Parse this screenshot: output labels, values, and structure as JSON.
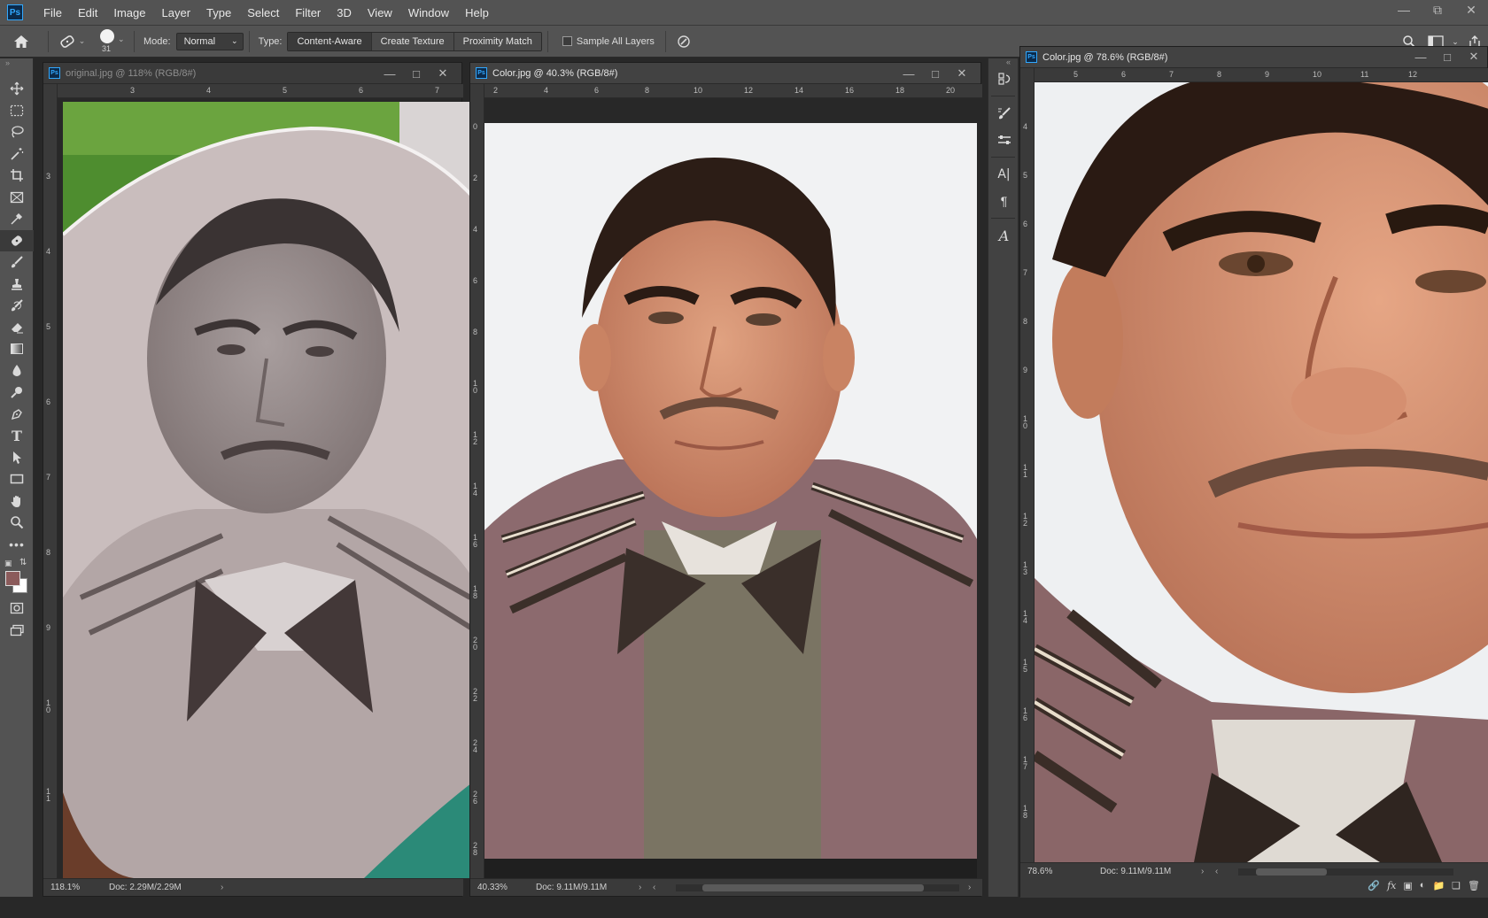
{
  "app": {
    "icon_text": "Ps"
  },
  "menu": [
    "File",
    "Edit",
    "Image",
    "Layer",
    "Type",
    "Select",
    "Filter",
    "3D",
    "View",
    "Window",
    "Help"
  ],
  "options": {
    "brush_size": "31",
    "mode_label": "Mode:",
    "mode_value": "Normal",
    "type_label": "Type:",
    "type_buttons": [
      "Content-Aware",
      "Create Texture",
      "Proximity Match"
    ],
    "sample_all_layers": "Sample All Layers"
  },
  "doc1": {
    "title": "original.jpg @ 118% (RGB/8#)",
    "zoom": "118.1%",
    "docsize": "Doc: 2.29M/2.29M",
    "ruler_h": [
      "3",
      "4",
      "5",
      "6",
      "7"
    ],
    "ruler_v": [
      "3",
      "4",
      "5",
      "6",
      "7",
      "8",
      "9",
      "1 0",
      "1 1"
    ]
  },
  "doc2": {
    "title": "Color.jpg @ 40.3% (RGB/8#)",
    "zoom": "40.33%",
    "docsize": "Doc: 9.11M/9.11M",
    "ruler_h": [
      "2",
      "4",
      "6",
      "8",
      "10",
      "12",
      "14",
      "16",
      "18",
      "20"
    ],
    "ruler_v": [
      "0",
      "2",
      "4",
      "6",
      "8",
      "1 0",
      "1 2",
      "1 4",
      "1 6",
      "1 8",
      "2 0",
      "2 2",
      "2 4",
      "2 6",
      "2 8"
    ]
  },
  "doc3": {
    "title": "Color.jpg @ 78.6% (RGB/8#)",
    "zoom": "78.6%",
    "docsize": "Doc: 9.11M/9.11M",
    "ruler_h": [
      "5",
      "6",
      "7",
      "8",
      "9",
      "10",
      "11",
      "12"
    ],
    "ruler_v": [
      "4",
      "5",
      "6",
      "7",
      "8",
      "9",
      "1 0",
      "1 1",
      "1 2",
      "1 3",
      "1 4",
      "1 5",
      "1 6",
      "1 7",
      "1 8"
    ]
  },
  "colors": {
    "foreground": "#8b5b5b",
    "background": "#ffffff",
    "accent": "#31a8ff"
  },
  "toolbar_icons": [
    "move-icon",
    "marquee-icon",
    "lasso-icon",
    "magic-wand-icon",
    "crop-icon",
    "frame-icon",
    "eyedropper-icon",
    "healing-brush-icon",
    "brush-icon",
    "stamp-icon",
    "history-brush-icon",
    "eraser-icon",
    "gradient-icon",
    "blur-icon",
    "dodge-icon",
    "pen-icon",
    "type-icon",
    "path-select-icon",
    "rectangle-icon",
    "hand-icon",
    "zoom-icon",
    "more-icon"
  ]
}
